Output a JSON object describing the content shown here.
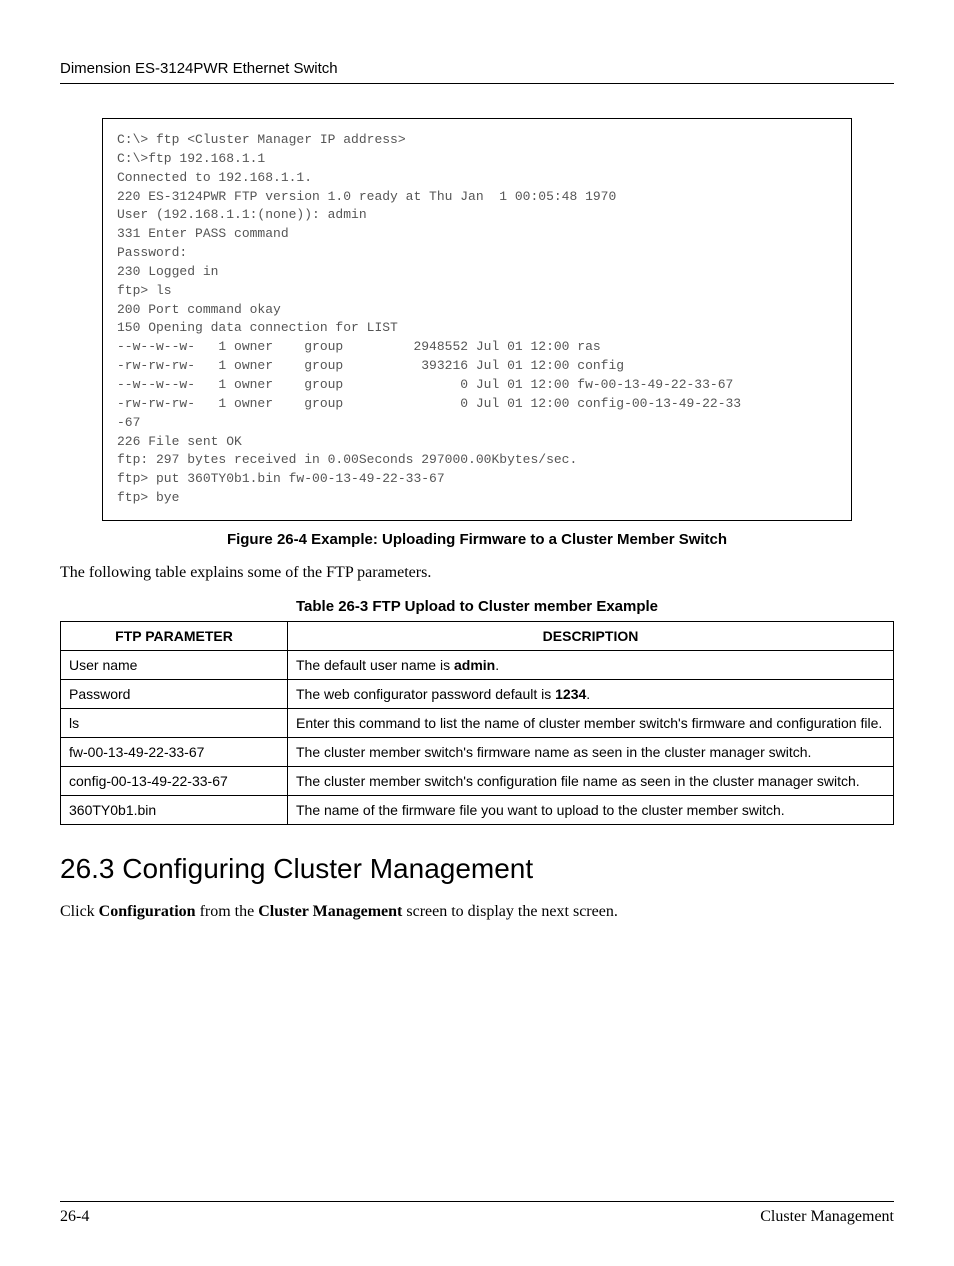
{
  "header": {
    "title": "Dimension ES-3124PWR Ethernet Switch"
  },
  "code": "C:\\> ftp <Cluster Manager IP address>\nC:\\>ftp 192.168.1.1\nConnected to 192.168.1.1.\n220 ES-3124PWR FTP version 1.0 ready at Thu Jan  1 00:05:48 1970\nUser (192.168.1.1:(none)): admin\n331 Enter PASS command\nPassword:\n230 Logged in\nftp> ls\n200 Port command okay\n150 Opening data connection for LIST\n--w--w--w-   1 owner    group         2948552 Jul 01 12:00 ras\n-rw-rw-rw-   1 owner    group          393216 Jul 01 12:00 config\n--w--w--w-   1 owner    group               0 Jul 01 12:00 fw-00-13-49-22-33-67\n-rw-rw-rw-   1 owner    group               0 Jul 01 12:00 config-00-13-49-22-33\n-67\n226 File sent OK\nftp: 297 bytes received in 0.00Seconds 297000.00Kbytes/sec.\nftp> put 360TY0b1.bin fw-00-13-49-22-33-67\nftp> bye",
  "figure_caption": "Figure 26-4 Example: Uploading Firmware to a Cluster Member Switch",
  "intro_text": "The following table explains some of the FTP parameters.",
  "table_caption": "Table 26-3 FTP Upload to Cluster member Example",
  "table": {
    "headers": [
      "FTP PARAMETER",
      "DESCRIPTION"
    ],
    "rows": [
      {
        "param": "User name",
        "desc_pre": "The default user name is ",
        "desc_bold": "admin",
        "desc_post": "."
      },
      {
        "param": "Password",
        "desc_pre": "The web configurator password default is ",
        "desc_bold": "1234",
        "desc_post": "."
      },
      {
        "param": "ls",
        "desc_pre": "Enter this command to list the name of cluster member switch's firmware and configuration file.",
        "desc_bold": "",
        "desc_post": ""
      },
      {
        "param": "fw-00-13-49-22-33-67",
        "desc_pre": "The cluster member switch's firmware name as seen in the cluster manager switch.",
        "desc_bold": "",
        "desc_post": ""
      },
      {
        "param": "config-00-13-49-22-33-67",
        "desc_pre": "The cluster member switch's configuration file name as seen in the cluster manager switch.",
        "desc_bold": "",
        "desc_post": ""
      },
      {
        "param": "360TY0b1.bin",
        "desc_pre": "The name of the firmware file you want to upload to the cluster member switch.",
        "desc_bold": "",
        "desc_post": ""
      }
    ]
  },
  "section": {
    "number": "26.3",
    "title": "Configuring Cluster Management",
    "body_pre": "Click ",
    "body_b1": "Configuration",
    "body_mid": " from the ",
    "body_b2": "Cluster Management",
    "body_post": " screen to display the next screen."
  },
  "footer": {
    "left": "26-4",
    "right": "Cluster Management"
  }
}
